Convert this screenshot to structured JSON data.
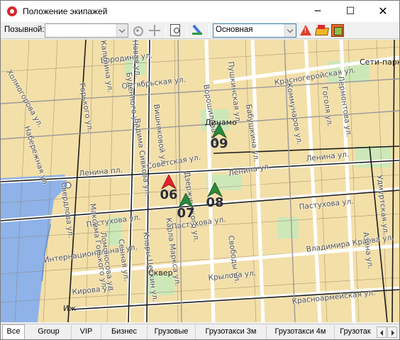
{
  "window": {
    "title": "Положение экипажей",
    "controls": {
      "minimize": "─",
      "maximize": "☐",
      "close": "✕"
    }
  },
  "toolbar": {
    "callsign_label": "Позывной:",
    "callsign_value": "",
    "layer_value": "Основная",
    "icons": [
      "locate-icon",
      "center-map-icon",
      "print-preview-icon",
      "edit-route-icon",
      "roadwork-icon",
      "accident-icon",
      "traffic-icon"
    ]
  },
  "map": {
    "colors": {
      "land": "#f3dfa8",
      "water": "#8fb2e8",
      "park": "#cde8b8",
      "road": "#ffffff",
      "railway": "#222222",
      "vehicle_alert": "#e0232b",
      "vehicle_ok": "#2b8a3a"
    },
    "streets": [
      "Бородина ул.",
      "Горького ул.",
      "Калинина ул.",
      "Новая ул.",
      "Октябрьская ул.",
      "Буденного ул.",
      "Вишняковой ул.",
      "Пушкинская ул.",
      "Ворошилова ул.",
      "Красногеройская ул.",
      "Сети-парк",
      "Коммунаров ул.",
      "Гоголя ул.",
      "Лермонтова ул.",
      "Советская ул.",
      "Ленина пл.",
      "Ленина ул.",
      "Дзержинского ул.",
      "Карла Маркса ул.",
      "Пастухова ул.",
      "Максима Горького ул.",
      "Интернациональная ул.",
      "Свободы ул.",
      "Владимира Краева ул.",
      "Красноармейская ул.",
      "Удмуртская ул.",
      "Клары Цеткин ул.",
      "Крылова ул.",
      "Кирова ул.",
      "Холмогорова ул.",
      "Вадима Сивкова ул.",
      "Сенная ул.",
      "Свердлова ул.",
      "Азина ул.",
      "Бабушкина ул.",
      "Ломоносова ул.",
      "Набережная ул."
    ],
    "places": {
      "stadium": "Динамо",
      "square": "Сквер",
      "river": "Иж"
    },
    "vehicles": [
      {
        "id": "06",
        "status": "alert"
      },
      {
        "id": "07",
        "status": "ok"
      },
      {
        "id": "08",
        "status": "ok"
      },
      {
        "id": "09",
        "status": "ok"
      }
    ]
  },
  "tabs": [
    "Все",
    "Group",
    "VIP",
    "Бизнес",
    "Грузовые",
    "Грузотакси 3м",
    "Грузотакси 4м",
    "Грузотак"
  ],
  "active_tab": "Все"
}
